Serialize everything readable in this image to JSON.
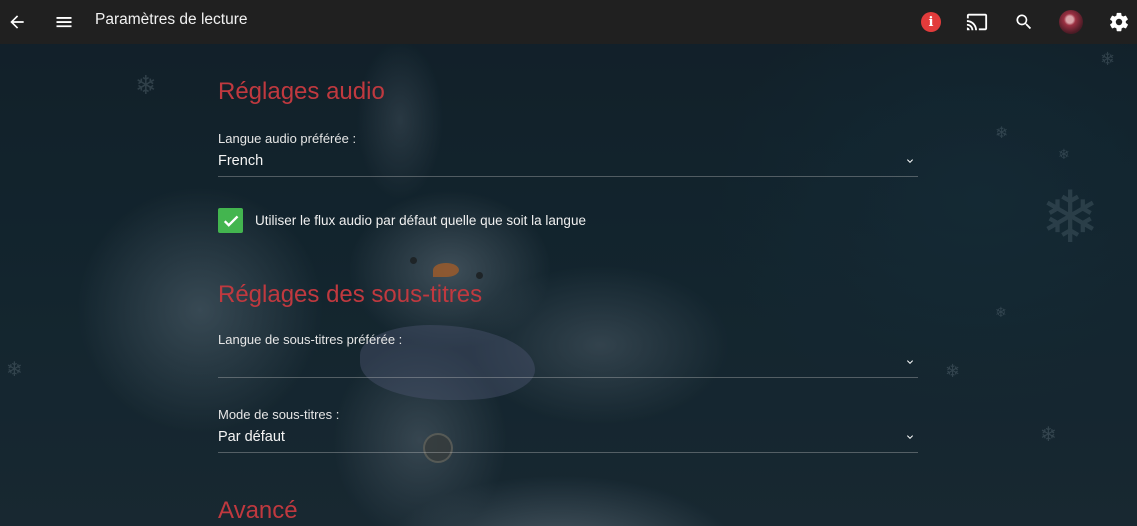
{
  "header": {
    "title": "Paramètres de lecture",
    "icons": [
      "back-arrow-icon",
      "menu-icon",
      "info-icon",
      "cast-icon",
      "search-icon",
      "avatar",
      "gear-icon"
    ],
    "info_badge_text": "i",
    "accent": "#e23b3b"
  },
  "audio": {
    "section_title": "Réglages audio",
    "language_label": "Langue audio préférée :",
    "language_value": "French",
    "checkbox_label": "Utiliser le flux audio par défaut quelle que soit la langue",
    "checkbox_checked": true
  },
  "subtitles": {
    "section_title": "Réglages des sous-titres",
    "language_label": "Langue de sous-titres préférée :",
    "language_value": "",
    "mode_label": "Mode de sous-titres :",
    "mode_value": "Par défaut"
  },
  "advanced": {
    "section_title": "Avancé"
  },
  "colors": {
    "section_title": "#c0393f",
    "checkbox": "#43b54f",
    "appbar": "#202020"
  }
}
